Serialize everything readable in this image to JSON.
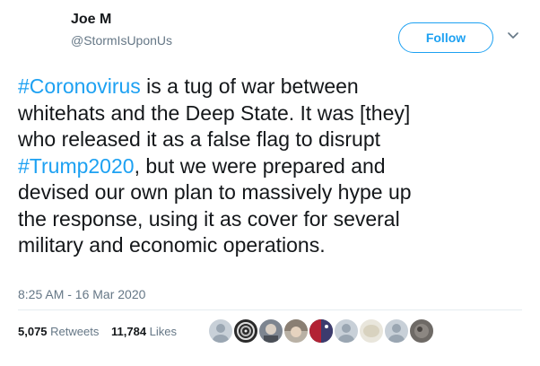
{
  "user": {
    "display_name": "Joe M",
    "handle": "@StormIsUponUs"
  },
  "follow_label": "Follow",
  "tweet": {
    "segments": [
      {
        "text": "#Coronovirus",
        "kind": "hashtag"
      },
      {
        "text": " is a tug of war between\nwhitehats and the Deep State. It was [they]\nwho released it as a false flag to disrupt\n",
        "kind": "text"
      },
      {
        "text": "#Trump2020",
        "kind": "hashtag"
      },
      {
        "text": ", but we were prepared and\ndevised our own plan to massively hype up\nthe response, using it as cover for several\nmilitary and economic operations.",
        "kind": "text"
      }
    ],
    "timestamp": "8:25 AM - 16 Mar 2020"
  },
  "stats": {
    "retweets_count": "5,075",
    "retweets_label": "Retweets",
    "likes_count": "11,784",
    "likes_label": "Likes"
  },
  "colors": {
    "accent": "#1da1f2",
    "text": "#14171a",
    "muted": "#657786"
  },
  "icons": [
    "chevron-down-icon",
    "liker-avatar"
  ]
}
